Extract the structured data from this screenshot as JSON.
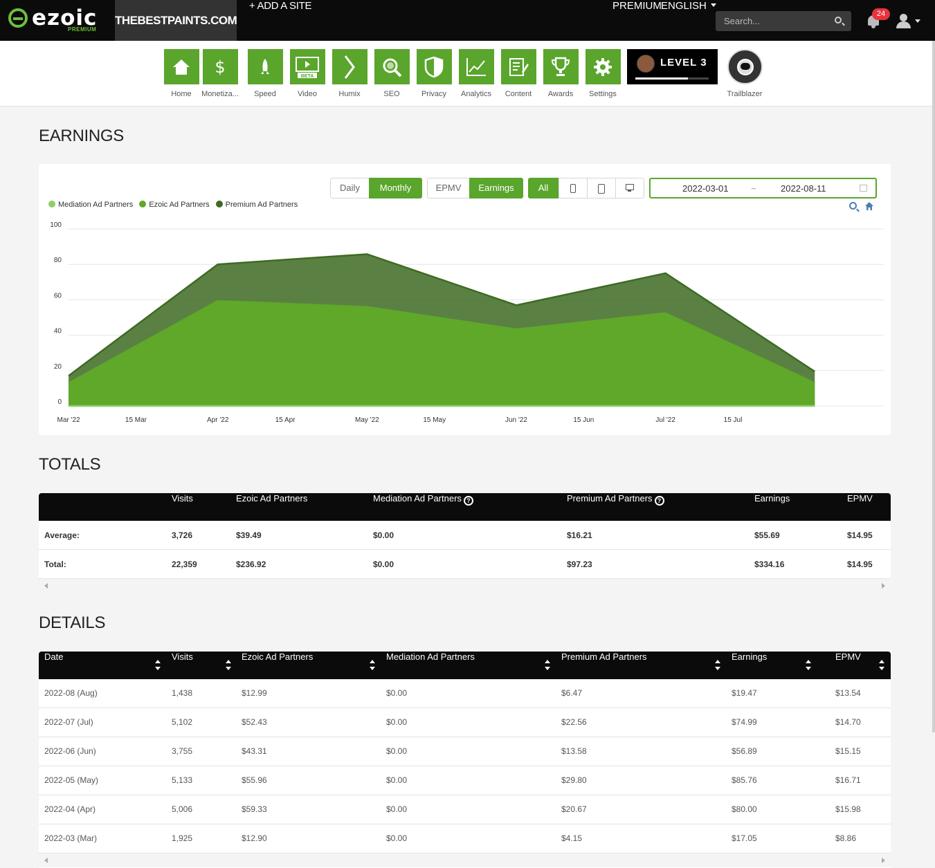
{
  "brand": {
    "name": "ezoic",
    "tier": "PREMIUM",
    "accent": "#5aa52c"
  },
  "topbar": {
    "site": "THEBESTPAINTS.COM",
    "add_site": "+ ADD A SITE",
    "premium": "PREMIUM",
    "language": "ENGLISH",
    "search_placeholder": "Search...",
    "notifications": "24"
  },
  "nav": {
    "items": [
      {
        "label": "Home",
        "icon": "home-icon"
      },
      {
        "label": "Monetiza...",
        "icon": "dollar-icon"
      },
      {
        "label": "Speed",
        "icon": "rocket-icon"
      },
      {
        "label": "Video",
        "icon": "video-icon",
        "badge": "BETA"
      },
      {
        "label": "Humix",
        "icon": "chevron-right-icon"
      },
      {
        "label": "SEO",
        "icon": "magnifier-icon"
      },
      {
        "label": "Privacy",
        "icon": "shield-icon"
      },
      {
        "label": "Analytics",
        "icon": "line-chart-icon"
      },
      {
        "label": "Content",
        "icon": "document-edit-icon"
      },
      {
        "label": "Awards",
        "icon": "trophy-icon"
      },
      {
        "label": "Settings",
        "icon": "gear-icon"
      }
    ],
    "level": "LEVEL 3",
    "level_progress": 0.72,
    "trailblazer": "Trailblazer"
  },
  "earnings": {
    "title": "EARNINGS",
    "buttons": {
      "daily": "Daily",
      "monthly": "Monthly",
      "epmv": "EPMV",
      "earnings": "Earnings",
      "all": "All"
    },
    "date_start": "2022-03-01",
    "date_sep": "~",
    "date_end": "2022-08-11"
  },
  "chart_data": {
    "type": "area",
    "stacked": true,
    "x": [
      "2022-03-01",
      "2022-04-01",
      "2022-05-01",
      "2022-06-01",
      "2022-07-01",
      "2022-08-01"
    ],
    "x_ticks": [
      "Mar '22",
      "15 Mar",
      "Apr '22",
      "15 Apr",
      "May '22",
      "15 May",
      "Jun '22",
      "15 Jun",
      "Jul '22",
      "15 Jul"
    ],
    "y_ticks": [
      "0",
      "20",
      "40",
      "60",
      "80",
      "100"
    ],
    "ylim": [
      0,
      100
    ],
    "series": [
      {
        "name": "Mediation Ad Partners",
        "color": "#8fcf6b",
        "values": [
          0,
          0,
          0,
          0,
          0,
          0
        ]
      },
      {
        "name": "Ezoic Ad Partners",
        "color": "#5fa82a",
        "values": [
          12.9,
          59.33,
          55.96,
          43.31,
          52.43,
          12.99
        ]
      },
      {
        "name": "Premium Ad Partners",
        "color": "#3d6b22",
        "values": [
          4.15,
          20.67,
          29.8,
          13.58,
          22.56,
          6.47
        ]
      }
    ],
    "legend": "top-left",
    "grid": true
  },
  "totals": {
    "title": "TOTALS",
    "headers": [
      "",
      "Visits",
      "Ezoic Ad Partners",
      "Mediation Ad Partners",
      "Premium Ad Partners",
      "Earnings",
      "EPMV"
    ],
    "rows": [
      [
        "Average:",
        "3,726",
        "$39.49",
        "$0.00",
        "$16.21",
        "$55.69",
        "$14.95"
      ],
      [
        "Total:",
        "22,359",
        "$236.92",
        "$0.00",
        "$97.23",
        "$334.16",
        "$14.95"
      ]
    ]
  },
  "details": {
    "title": "DETAILS",
    "headers": [
      "Date",
      "Visits",
      "Ezoic Ad Partners",
      "Mediation Ad Partners",
      "Premium Ad Partners",
      "Earnings",
      "EPMV"
    ],
    "rows": [
      [
        "2022-08 (Aug)",
        "1,438",
        "$12.99",
        "$0.00",
        "$6.47",
        "$19.47",
        "$13.54"
      ],
      [
        "2022-07 (Jul)",
        "5,102",
        "$52.43",
        "$0.00",
        "$22.56",
        "$74.99",
        "$14.70"
      ],
      [
        "2022-06 (Jun)",
        "3,755",
        "$43.31",
        "$0.00",
        "$13.58",
        "$56.89",
        "$15.15"
      ],
      [
        "2022-05 (May)",
        "5,133",
        "$55.96",
        "$0.00",
        "$29.80",
        "$85.76",
        "$16.71"
      ],
      [
        "2022-04 (Apr)",
        "5,006",
        "$59.33",
        "$0.00",
        "$20.67",
        "$80.00",
        "$15.98"
      ],
      [
        "2022-03 (Mar)",
        "1,925",
        "$12.90",
        "$0.00",
        "$4.15",
        "$17.05",
        "$8.86"
      ]
    ]
  }
}
